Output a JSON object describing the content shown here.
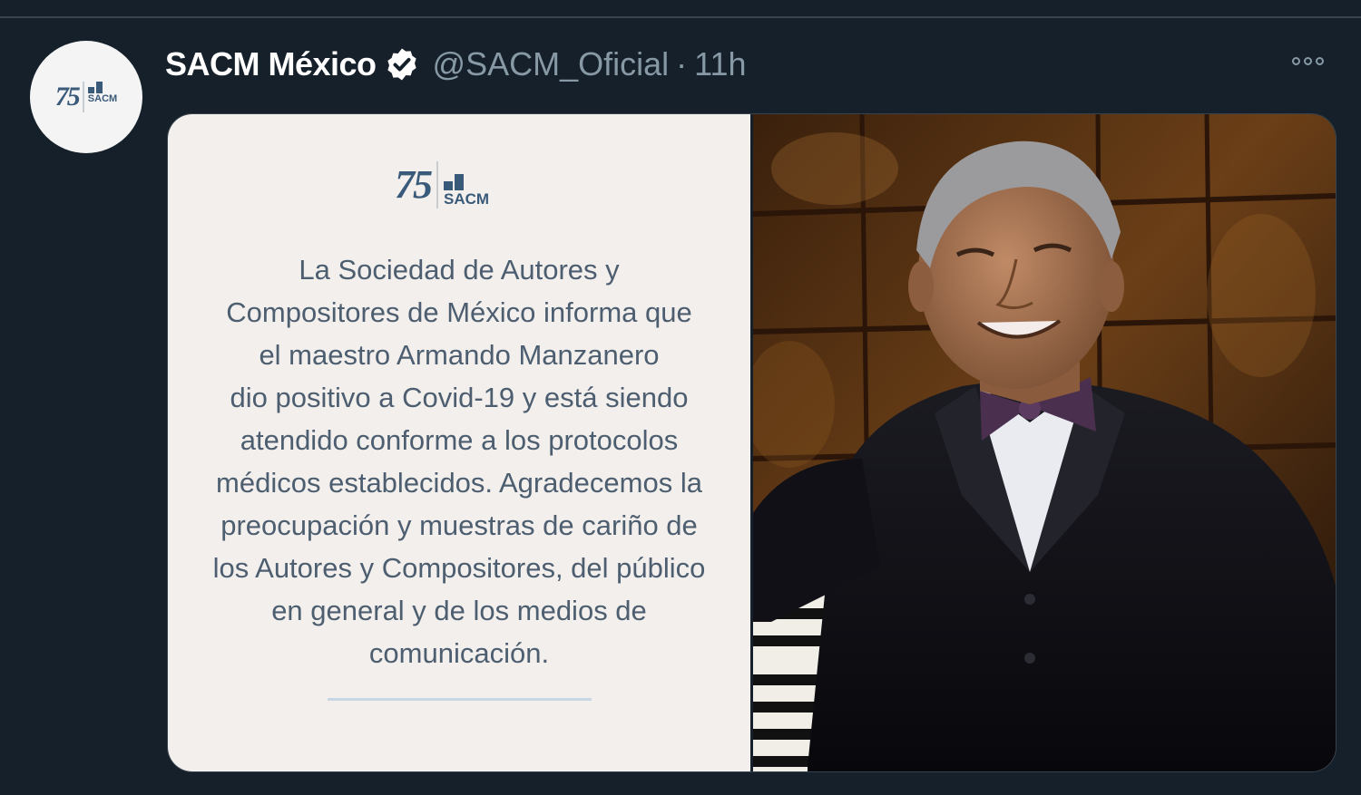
{
  "tweet": {
    "display_name": "SACM México",
    "handle": "@SACM_Oficial",
    "separator": "·",
    "timestamp": "11h",
    "more_icon": "more-horizontal-icon",
    "verified_icon": "verified-badge-icon"
  },
  "logo": {
    "anniversary": "75",
    "brand": "SACM"
  },
  "card": {
    "statement_lines": [
      "La Sociedad de Autores y",
      "Compositores de México informa que",
      "el maestro Armando Manzanero",
      "dio positivo a Covid-19 y está siendo",
      "atendido conforme a los protocolos",
      "médicos establecidos. Agradecemos la",
      "preocupación y muestras de cariño de",
      "los Autores y Compositores, del público",
      "en general y de los medios de",
      "comunicación."
    ]
  },
  "colors": {
    "background": "#15202b",
    "name": "#ffffff",
    "secondary": "#8899a6",
    "card_bg": "#f3efec",
    "card_text": "#4c5e70",
    "brand_blue": "#3a5a7a"
  }
}
